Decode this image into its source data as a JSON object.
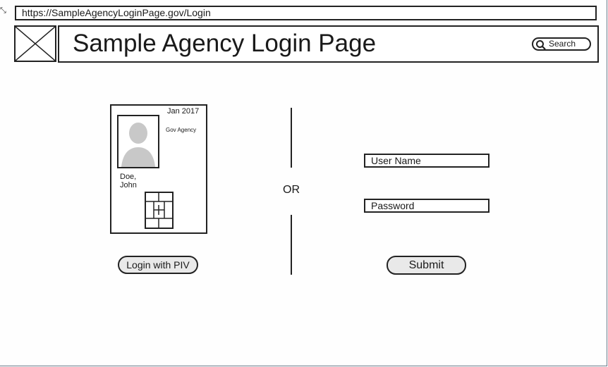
{
  "browser": {
    "url": "https://SampleAgencyLoginPage.gov/Login"
  },
  "header": {
    "logo_icon": "image-placeholder-icon",
    "title": "Sample Agency Login Page",
    "search": {
      "icon": "search-icon",
      "label": "Search"
    }
  },
  "piv": {
    "badge": {
      "date": "Jan 2017",
      "agency": "Gov Agency",
      "photo_icon": "person-silhouette-icon",
      "name_line1": "Doe,",
      "name_line2": "John",
      "chip_icon": "smartcard-chip-icon"
    },
    "button_label": "Login with PIV"
  },
  "separator": {
    "label": "OR"
  },
  "login_form": {
    "username_placeholder": "User Name",
    "password_placeholder": "Password",
    "submit_label": "Submit"
  },
  "colors": {
    "stroke": "#222222",
    "button_fill": "#e9e9e9",
    "photo_gray": "#c8c8c8"
  }
}
